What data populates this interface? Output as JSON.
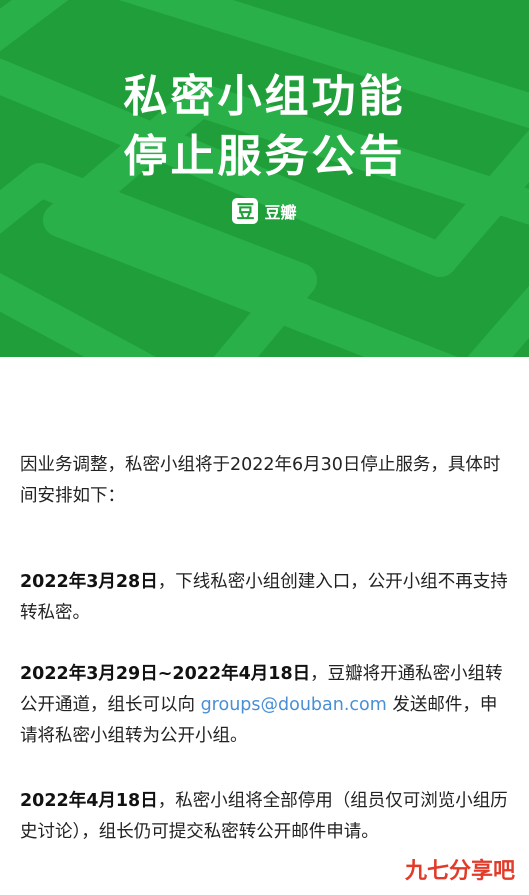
{
  "banner": {
    "title_line1": "私密小组功能",
    "title_line2": "停止服务公告",
    "logo_char": "豆",
    "brand_name": "豆瓣",
    "color": "#1f9e3a"
  },
  "notice": {
    "intro": "因业务调整，私密小组将于2022年6月30日停止服务，具体时间安排如下：",
    "item1_date": "2022年3月28日",
    "item1_text": "，下线私密小组创建入口，公开小组不再支持转私密。",
    "item2_date": "2022年3月29日~2022年4月18日",
    "item2_text_a": "，豆瓣将开通私密小组转公开通道，组长可以向 ",
    "item2_email": "groups@douban.com",
    "item2_text_b": " 发送邮件，申请将私密小组转为公开小组。",
    "item3_date": "2022年4月18日",
    "item3_text": "，私密小组将全部停用（组员仅可浏览小组历史讨论），组长仍可提交私密转公开邮件申请。"
  },
  "watermark": "九七分享吧"
}
